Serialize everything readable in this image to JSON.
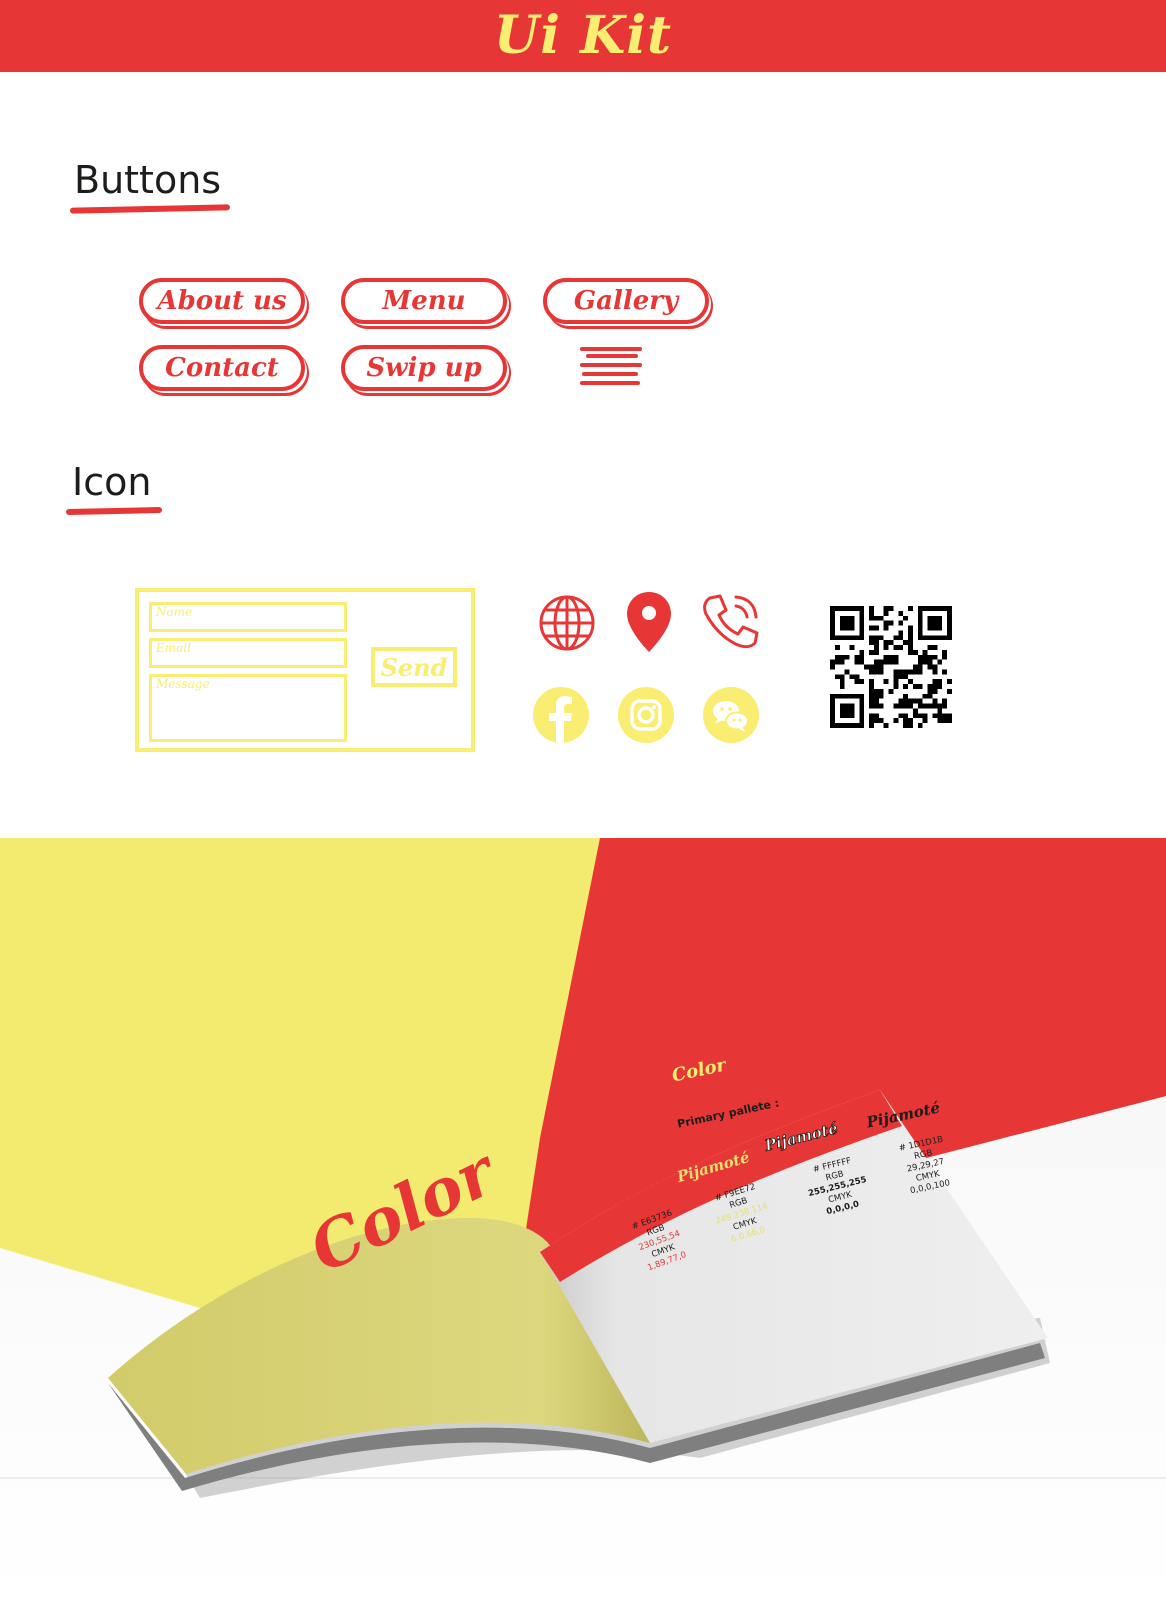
{
  "header": {
    "title": "Ui Kit"
  },
  "sections": {
    "buttons": {
      "title": "Buttons"
    },
    "icon": {
      "title": "Icon"
    }
  },
  "buttons": [
    "About us",
    "Menu",
    "Gallery",
    "Contact",
    "Swip up"
  ],
  "form": {
    "name_placeholder": "Name",
    "email_placeholder": "Email",
    "message_placeholder": "Message",
    "send_label": "Send"
  },
  "icons": {
    "row1": [
      "globe-icon",
      "location-pin-icon",
      "phone-icon"
    ],
    "row2": [
      "facebook-icon",
      "instagram-icon",
      "wechat-icon"
    ],
    "qr": "qr-code-icon"
  },
  "brochure": {
    "cover_text": "Color",
    "page_header": "Color",
    "palette_title": "Primary pallete :",
    "brand": "Pijamoté",
    "swatches": [
      {
        "hex": "# E63736",
        "rgb_label": "RGB",
        "rgb": "230,55,54",
        "cmyk_label": "CMYK",
        "cmyk": "1,89,77,0"
      },
      {
        "hex": "# F9EE72",
        "rgb_label": "RGB",
        "rgb": "249,238,114",
        "cmyk_label": "CMYK",
        "cmyk": "6,0,66,0"
      },
      {
        "hex": "# FFFFFF",
        "rgb_label": "RGB",
        "rgb": "255,255,255",
        "cmyk_label": "CMYK",
        "cmyk": "0,0,0,0"
      },
      {
        "hex": "# 1D1D1B",
        "rgb_label": "RGB",
        "rgb": "29,29,27",
        "cmyk_label": "CMYK",
        "cmyk": "0,0,0,100"
      }
    ]
  },
  "colors": {
    "red": "#E63736",
    "yellow": "#F9EE72",
    "white": "#FFFFFF",
    "black": "#1D1D1B"
  }
}
